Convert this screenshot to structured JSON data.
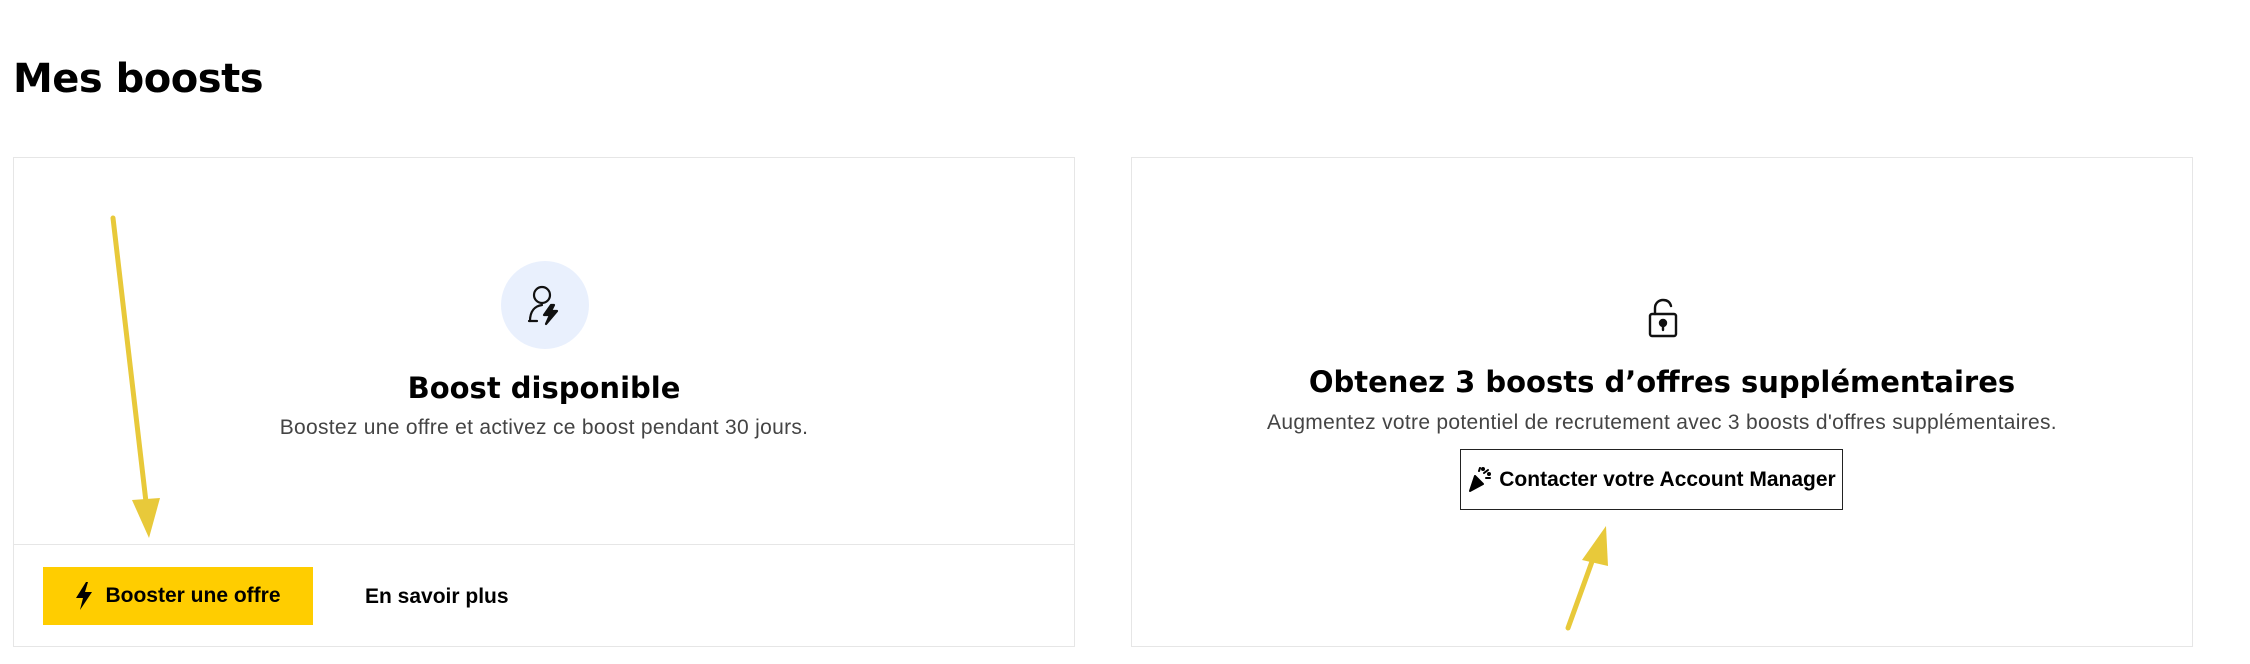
{
  "page": {
    "title": "Mes boosts"
  },
  "boost_card": {
    "icon": "user-bolt-icon",
    "title": "Boost disponible",
    "description": "Boostez une offre et activez ce boost pendant 30 jours.",
    "primary_button": {
      "icon": "bolt-icon",
      "label": "Booster une offre"
    },
    "secondary_link": "En savoir plus"
  },
  "upsell_card": {
    "icon": "unlock-icon",
    "title": "Obtenez 3 boosts d’offres supplémentaires",
    "description": "Augmentez votre potentiel de recrutement avec 3 boosts d'offres supplémentaires.",
    "button": {
      "icon": "party-popper-icon",
      "label": "Contacter votre Account Manager"
    }
  },
  "colors": {
    "accent": "#ffcd00",
    "icon_bg": "#e9f0fd",
    "border": "#e6e6e6",
    "annotation_arrow": "#e8c93a"
  }
}
